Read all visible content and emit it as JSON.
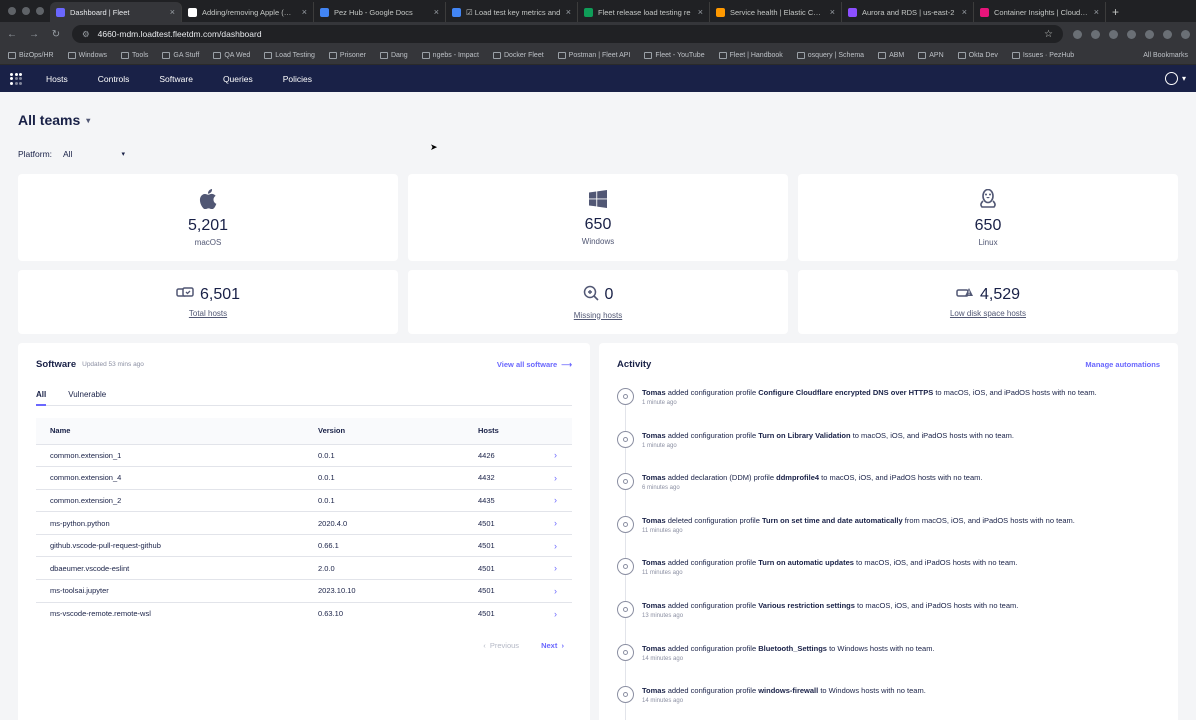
{
  "browser": {
    "tabs": [
      {
        "title": "Dashboard | Fleet",
        "color": "#6a67fe",
        "active": true
      },
      {
        "title": "Adding/removing Apple (mac",
        "color": "#ffffff",
        "active": false
      },
      {
        "title": "Pez Hub - Google Docs",
        "color": "#4285f4",
        "active": false
      },
      {
        "title": "☑ Load test key metrics and",
        "color": "#4285f4",
        "active": false
      },
      {
        "title": "Fleet release load testing re",
        "color": "#0f9d58",
        "active": false
      },
      {
        "title": "Service health | Elastic Conta",
        "color": "#ff9900",
        "active": false
      },
      {
        "title": "Aurora and RDS | us-east-2",
        "color": "#8c4fff",
        "active": false
      },
      {
        "title": "Container Insights | CloudWa",
        "color": "#e7157b",
        "active": false
      }
    ],
    "url": "4660-mdm.loadtest.fleetdm.com/dashboard",
    "bookmarks": [
      "BizOps/HR",
      "Windows",
      "Tools",
      "GA Stuff",
      "QA Wed",
      "Load Testing",
      "Prisoner",
      "Dang",
      "ngebs - Impact",
      "Docker Fleet",
      "Postman | Fleet API",
      "Fleet - YouTube",
      "Fleet | Handbook",
      "osquery | Schema",
      "ABM",
      "APN",
      "Okta Dev",
      "Issues · PezHub"
    ],
    "all_bookmarks": "All Bookmarks"
  },
  "nav": {
    "items": [
      "Hosts",
      "Controls",
      "Software",
      "Queries",
      "Policies"
    ]
  },
  "header": {
    "teams": "All teams",
    "platform_label": "Platform:",
    "platform_value": "All"
  },
  "platforms": [
    {
      "count": "5,201",
      "label": "macOS",
      "icon": "apple-icon"
    },
    {
      "count": "650",
      "label": "Windows",
      "icon": "windows-icon"
    },
    {
      "count": "650",
      "label": "Linux",
      "icon": "linux-icon"
    }
  ],
  "summary": [
    {
      "count": "6,501",
      "label": "Total hosts",
      "icon": "total-hosts-icon"
    },
    {
      "count": "0",
      "label": "Missing hosts",
      "icon": "missing-hosts-icon"
    },
    {
      "count": "4,529",
      "label": "Low disk space hosts",
      "icon": "low-disk-icon"
    }
  ],
  "software": {
    "title": "Software",
    "updated": "Updated 53 mins ago",
    "view_all": "View all software",
    "tabs": [
      "All",
      "Vulnerable"
    ],
    "columns": [
      "Name",
      "Version",
      "Hosts"
    ],
    "rows": [
      [
        "common.extension_1",
        "0.0.1",
        "4426"
      ],
      [
        "common.extension_4",
        "0.0.1",
        "4432"
      ],
      [
        "common.extension_2",
        "0.0.1",
        "4435"
      ],
      [
        "ms-python.python",
        "2020.4.0",
        "4501"
      ],
      [
        "github.vscode-pull-request-github",
        "0.66.1",
        "4501"
      ],
      [
        "dbaeumer.vscode-eslint",
        "2.0.0",
        "4501"
      ],
      [
        "ms-toolsai.jupyter",
        "2023.10.10",
        "4501"
      ],
      [
        "ms-vscode-remote.remote-wsl",
        "0.63.10",
        "4501"
      ]
    ],
    "previous": "Previous",
    "next": "Next"
  },
  "activity": {
    "title": "Activity",
    "manage": "Manage automations",
    "items": [
      {
        "actor": "Tomas",
        "pre": "added configuration profile",
        "object": "Configure Cloudflare encrypted DNS over HTTPS",
        "post": "to macOS, iOS, and iPadOS hosts with no team.",
        "ago": "1 minute ago"
      },
      {
        "actor": "Tomas",
        "pre": "added configuration profile",
        "object": "Turn on Library Validation",
        "post": "to macOS, iOS, and iPadOS hosts with no team.",
        "ago": "1 minute ago"
      },
      {
        "actor": "Tomas",
        "pre": "added declaration (DDM) profile",
        "object": "ddmprofile4",
        "post": "to macOS, iOS, and iPadOS hosts with no team.",
        "ago": "6 minutes ago"
      },
      {
        "actor": "Tomas",
        "pre": "deleted configuration profile",
        "object": "Turn on set time and date automatically",
        "post": "from macOS, iOS, and iPadOS hosts with no team.",
        "ago": "11 minutes ago"
      },
      {
        "actor": "Tomas",
        "pre": "added configuration profile",
        "object": "Turn on automatic updates",
        "post": "to macOS, iOS, and iPadOS hosts with no team.",
        "ago": "11 minutes ago"
      },
      {
        "actor": "Tomas",
        "pre": "added configuration profile",
        "object": "Various restriction settings",
        "post": "to macOS, iOS, and iPadOS hosts with no team.",
        "ago": "13 minutes ago"
      },
      {
        "actor": "Tomas",
        "pre": "added configuration profile",
        "object": "Bluetooth_Settings",
        "post": "to Windows hosts with no team.",
        "ago": "14 minutes ago"
      },
      {
        "actor": "Tomas",
        "pre": "added configuration profile",
        "object": "windows-firewall",
        "post": "to Windows hosts with no team.",
        "ago": "14 minutes ago"
      }
    ]
  }
}
